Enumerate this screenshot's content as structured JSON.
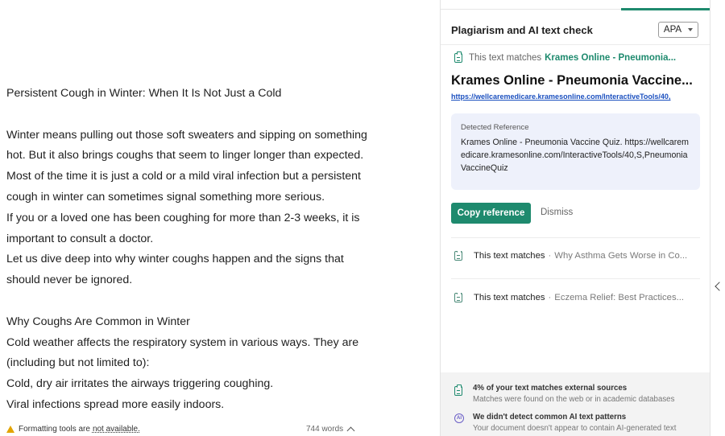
{
  "document": {
    "paragraphs": [
      "Persistent Cough in Winter: When It Is Not Just a Cold",
      "",
      "Winter means pulling out those soft sweaters and sipping on something",
      "hot. But it also brings coughs that seem to linger longer than expected.",
      "Most of the time it is just a cold or a mild viral infection but a persistent",
      "cough in winter can sometimes signal something more serious.",
      "If you or a loved one has been coughing for more than 2-3 weeks, it is",
      "important to consult a doctor.",
      "Let us dive deep into why winter coughs happen and the signs that",
      "should never be ignored.",
      "",
      "Why Coughs Are Common in Winter",
      "Cold weather affects the respiratory system in various ways. They are",
      "(including but not limited to):",
      "Cold, dry air irritates the airways triggering coughing.",
      "Viral infections spread more easily indoors."
    ]
  },
  "status_bar": {
    "formatting_prefix": "Formatting tools are",
    "formatting_suffix": "not available.",
    "word_count": "744 words"
  },
  "panel": {
    "title": "Plagiarism and AI text check",
    "citation_style": "APA",
    "active_match": {
      "label": "This text matches",
      "source_short": "Krames Online - Pneumonia...",
      "title": "Krames Online - Pneumonia Vaccine...",
      "url": "https://wellcaremedicare.kramesonline.com/InteractiveTools/40,",
      "reference_header": "Detected Reference",
      "reference_text": "Krames Online - Pneumonia Vaccine Quiz. https://wellcaremedicare.kramesonline.com/InteractiveTools/40,S,PneumoniaVaccineQuiz",
      "copy_label": "Copy reference",
      "dismiss_label": "Dismiss"
    },
    "other_matches": [
      {
        "label": "This text matches",
        "source": "Why Asthma Gets Worse in Co..."
      },
      {
        "label": "This text matches",
        "source": "Eczema Relief: Best Practices..."
      }
    ],
    "summary": {
      "plagiarism_title": "4% of your text matches external sources",
      "plagiarism_desc": "Matches were found on the web or in academic databases",
      "ai_title": "We didn't detect common AI text patterns",
      "ai_desc": "Your document doesn't appear to contain AI-generated text",
      "ai_icon_text": "AI"
    }
  },
  "colors": {
    "accent": "#1e8a6e",
    "link": "#1a4fbf",
    "reference_bg": "#eef1fb"
  }
}
